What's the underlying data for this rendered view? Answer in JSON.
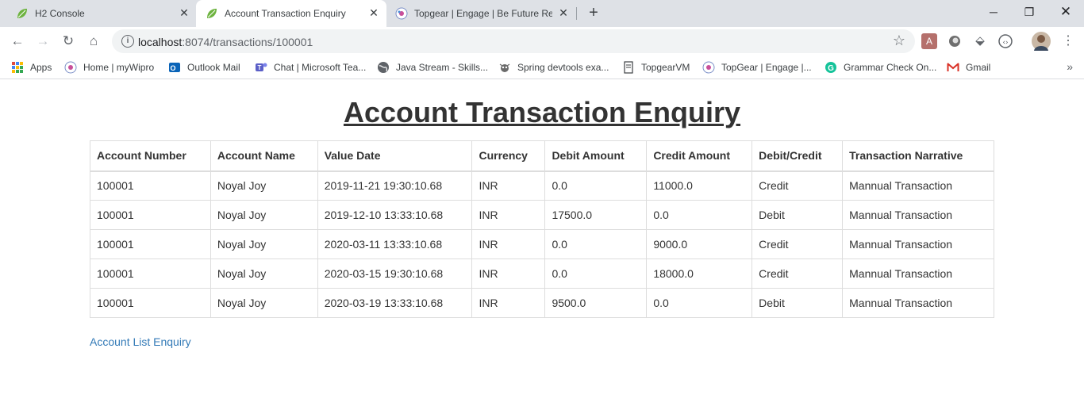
{
  "browser": {
    "tabs": [
      {
        "title": "H2 Console",
        "favicon": "spring-leaf-icon"
      },
      {
        "title": "Account Transaction Enquiry",
        "favicon": "spring-leaf-icon"
      },
      {
        "title": "Topgear | Engage | Be Future Rea",
        "favicon": "wipro-icon"
      }
    ],
    "address": {
      "host": "localhost",
      "rest": ":8074/transactions/100001"
    },
    "bookmarks": [
      {
        "label": "Apps",
        "icon": "apps-grid-icon"
      },
      {
        "label": "Home | myWipro",
        "icon": "wipro-icon"
      },
      {
        "label": "Outlook Mail",
        "icon": "outlook-icon"
      },
      {
        "label": "Chat | Microsoft Tea...",
        "icon": "teams-icon"
      },
      {
        "label": "Java Stream - Skills...",
        "icon": "globe-icon"
      },
      {
        "label": "Spring devtools exa...",
        "icon": "bug-icon"
      },
      {
        "label": "TopgearVM",
        "icon": "page-icon"
      },
      {
        "label": "TopGear | Engage |...",
        "icon": "wipro-icon"
      },
      {
        "label": "Grammar Check On...",
        "icon": "grammarly-icon"
      },
      {
        "label": "Gmail",
        "icon": "gmail-icon"
      }
    ]
  },
  "page": {
    "title": "Account Transaction Enquiry",
    "columns": [
      "Account Number",
      "Account Name",
      "Value Date",
      "Currency",
      "Debit Amount",
      "Credit Amount",
      "Debit/Credit",
      "Transaction Narrative"
    ],
    "rows": [
      [
        "100001",
        "Noyal Joy",
        "2019-11-21 19:30:10.68",
        "INR",
        "0.0",
        "11000.0",
        "Credit",
        "Mannual Transaction"
      ],
      [
        "100001",
        "Noyal Joy",
        "2019-12-10 13:33:10.68",
        "INR",
        "17500.0",
        "0.0",
        "Debit",
        "Mannual Transaction"
      ],
      [
        "100001",
        "Noyal Joy",
        "2020-03-11 13:33:10.68",
        "INR",
        "0.0",
        "9000.0",
        "Credit",
        "Mannual Transaction"
      ],
      [
        "100001",
        "Noyal Joy",
        "2020-03-15 19:30:10.68",
        "INR",
        "0.0",
        "18000.0",
        "Credit",
        "Mannual Transaction"
      ],
      [
        "100001",
        "Noyal Joy",
        "2020-03-19 13:33:10.68",
        "INR",
        "9500.0",
        "0.0",
        "Debit",
        "Mannual Transaction"
      ]
    ],
    "link_label": "Account List Enquiry"
  },
  "colors": {
    "link": "#337ab7",
    "text": "#333333",
    "tabstrip": "#dee1e6"
  }
}
